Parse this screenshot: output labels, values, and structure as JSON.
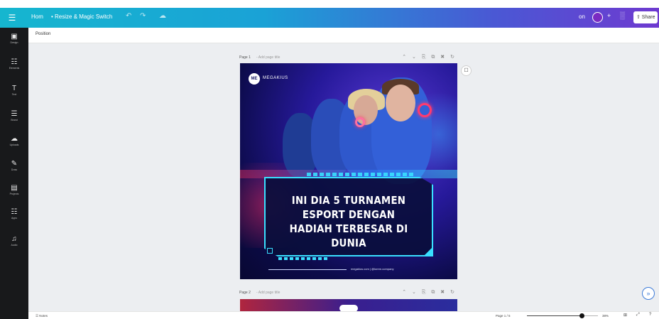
{
  "topbar": {
    "home_label": "Hom",
    "resize_label": "• Resize & Magic Switch",
    "undo_icon": "↶",
    "redo_icon": "↷",
    "cloud_icon": "☁",
    "file_name": "on",
    "add_user_icon": "+",
    "chart_icon": "░",
    "share_label": "⇧ Share"
  },
  "sidebar": {
    "items": [
      {
        "icon": "▣",
        "label": "Design"
      },
      {
        "icon": "☷",
        "label": "Elements"
      },
      {
        "icon": "T",
        "label": "Text"
      },
      {
        "icon": "☰",
        "label": "Brand"
      },
      {
        "icon": "☁",
        "label": "Uploads"
      },
      {
        "icon": "✎",
        "label": "Draw"
      },
      {
        "icon": "▤",
        "label": "Projects"
      },
      {
        "icon": "☷",
        "label": "Apps"
      },
      {
        "icon": "♫",
        "label": "Audio"
      }
    ]
  },
  "toolbar": {
    "position_label": "Position"
  },
  "page1": {
    "label": "Page 1",
    "title_placeholder": "- Add page title",
    "tools": "⌃ ⌄ ⎘ ⧉ ✖ ↻",
    "brand_logo_text": "ME",
    "brand_name": "MEGAKIUS",
    "headline": "INI DIA 5 TURNAMEN ESPORT DENGAN HADIAH TERBESAR DI DUNIA",
    "footer": "megakius.com  |  @lorem.company"
  },
  "comment_icon": "☐",
  "page2": {
    "label": "Page 2",
    "title_placeholder": "- Add page title",
    "tools": "⌃ ⌄ ⎘ ⧉ ✖ ↻"
  },
  "help_icon": "»",
  "statusbar": {
    "notes": "☰ Notes",
    "page_count": "Page 1 / 5",
    "zoom_value": "38%",
    "zoom_fraction": 0.77,
    "grid_icon": "⊞",
    "fullscreen_icon": "⤢",
    "help_icon": "?"
  }
}
